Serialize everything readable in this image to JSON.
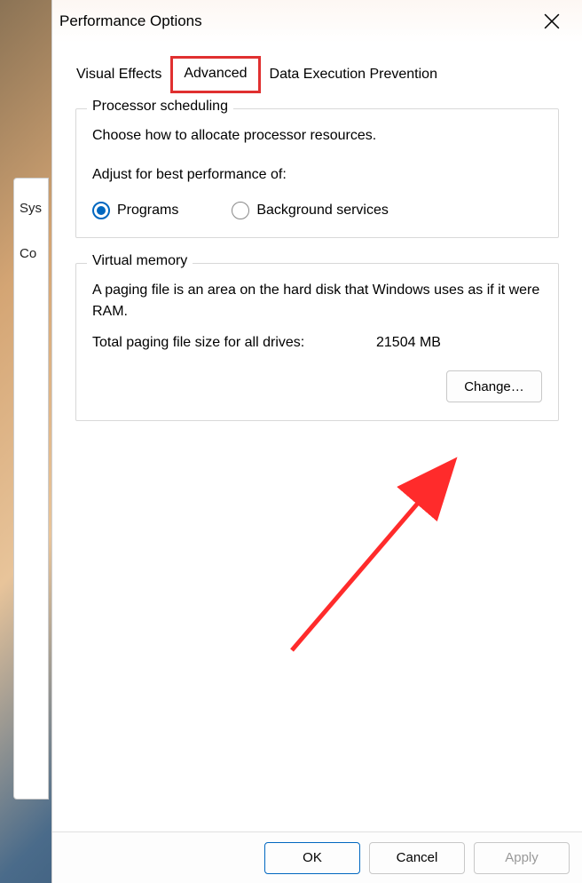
{
  "background": {
    "partial_tab1": "Sys",
    "partial_tab2": "Co"
  },
  "dialog": {
    "title": "Performance Options",
    "tabs": {
      "visual_effects": "Visual Effects",
      "advanced": "Advanced",
      "dep": "Data Execution Prevention"
    },
    "processor": {
      "title": "Processor scheduling",
      "description": "Choose how to allocate processor resources.",
      "adjust_label": "Adjust for best performance of:",
      "programs": "Programs",
      "background_services": "Background services",
      "selected": "programs"
    },
    "virtual_memory": {
      "title": "Virtual memory",
      "description": "A paging file is an area on the hard disk that Windows uses as if it were RAM.",
      "total_label": "Total paging file size for all drives:",
      "total_value": "21504 MB",
      "change_button": "Change…"
    },
    "buttons": {
      "ok": "OK",
      "cancel": "Cancel",
      "apply": "Apply"
    }
  }
}
